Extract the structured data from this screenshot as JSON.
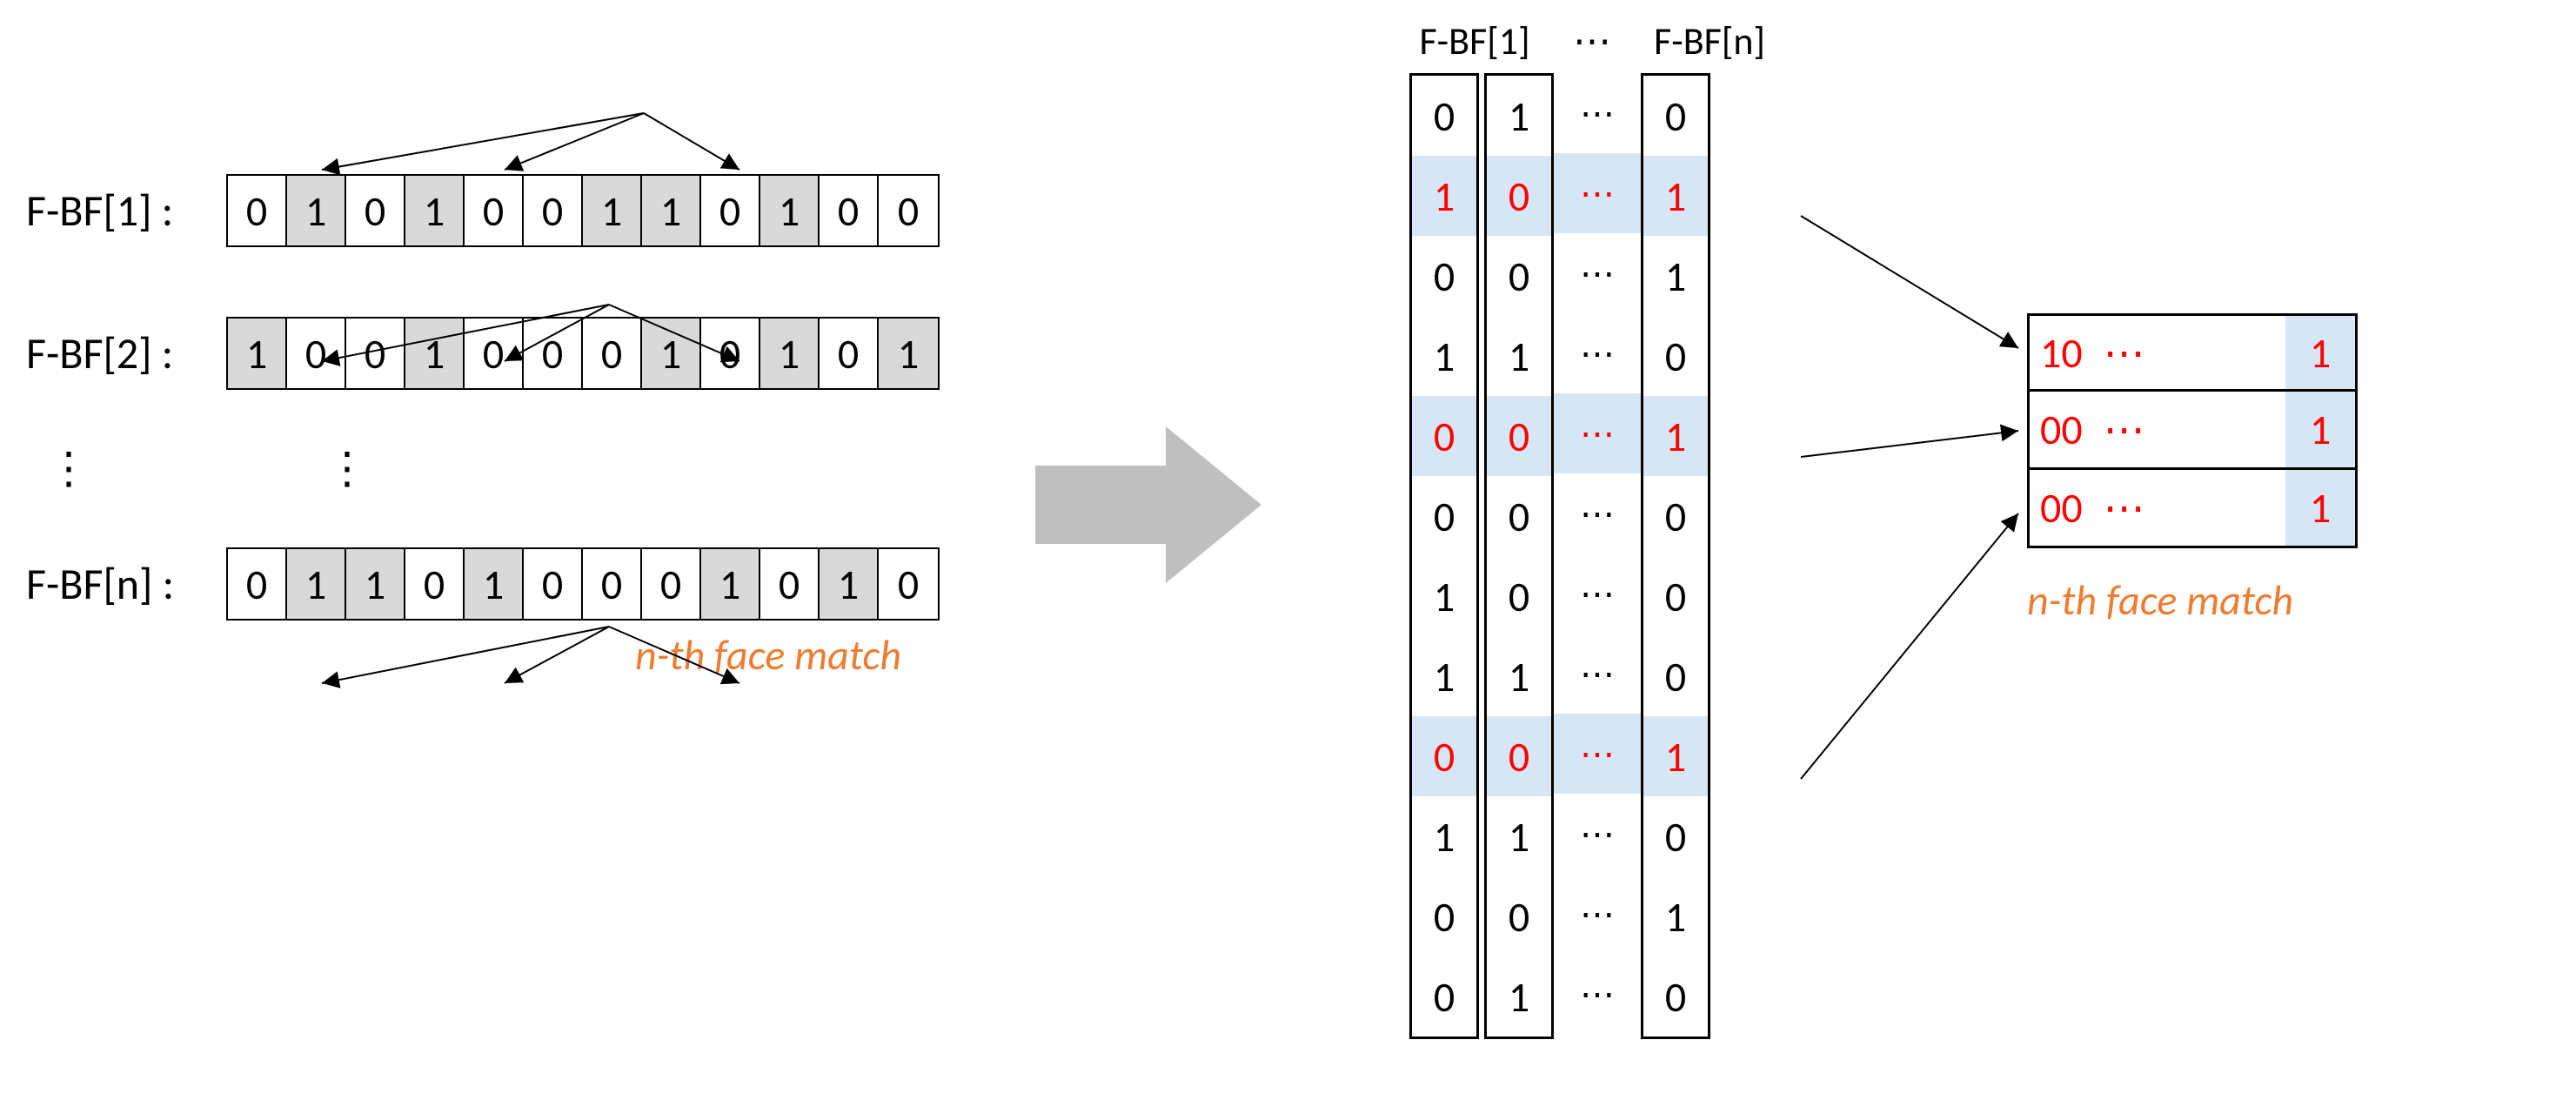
{
  "left": {
    "rows": [
      {
        "label": "F-BF[1] :",
        "bits": [
          "0",
          "1",
          "0",
          "1",
          "0",
          "0",
          "1",
          "1",
          "0",
          "1",
          "0",
          "0"
        ],
        "shaded": [
          0,
          1,
          0,
          1,
          0,
          0,
          1,
          1,
          0,
          1,
          0,
          0
        ]
      },
      {
        "label": "F-BF[2] :",
        "bits": [
          "1",
          "0",
          "0",
          "1",
          "0",
          "0",
          "0",
          "1",
          "0",
          "1",
          "0",
          "1"
        ],
        "shaded": [
          1,
          0,
          0,
          1,
          0,
          0,
          0,
          1,
          0,
          1,
          0,
          1
        ]
      },
      {
        "label": "F-BF[n] :",
        "bits": [
          "0",
          "1",
          "1",
          "0",
          "1",
          "0",
          "0",
          "0",
          "1",
          "0",
          "1",
          "0"
        ],
        "shaded": [
          0,
          1,
          1,
          0,
          1,
          0,
          0,
          0,
          1,
          0,
          1,
          0
        ]
      }
    ],
    "vdots": "⋮",
    "caption": "n-th face match"
  },
  "right": {
    "headers": {
      "h1": "F-BF[1]",
      "mid": "⋯",
      "hn": "F-BF[n]"
    },
    "col1": [
      "0",
      "1",
      "0",
      "1",
      "0",
      "0",
      "1",
      "1",
      "0",
      "1",
      "0",
      "0"
    ],
    "col2": [
      "1",
      "0",
      "0",
      "1",
      "0",
      "0",
      "0",
      "1",
      "0",
      "1",
      "0",
      "1"
    ],
    "midcol": [
      "⋯",
      "⋯",
      "⋯",
      "⋯",
      "⋯",
      "⋯",
      "⋯",
      "⋯",
      "⋯",
      "⋯",
      "⋯",
      "⋯"
    ],
    "coln": [
      "0",
      "1",
      "1",
      "0",
      "1",
      "0",
      "0",
      "0",
      "1",
      "0",
      "1",
      "0"
    ],
    "highlightRows": [
      1,
      4,
      8
    ]
  },
  "match": {
    "rows": [
      {
        "prefix": "10",
        "mid": "⋯",
        "last": "1"
      },
      {
        "prefix": "00",
        "mid": "⋯",
        "last": "1"
      },
      {
        "prefix": "00",
        "mid": "⋯",
        "last": "1"
      }
    ],
    "caption": "n-th face match"
  }
}
